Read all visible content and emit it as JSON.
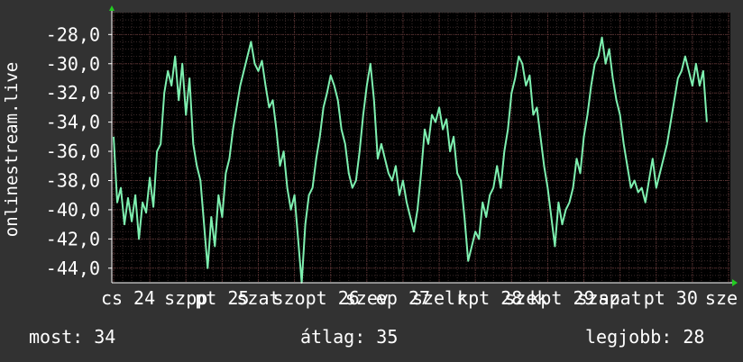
{
  "chart_data": {
    "type": "line",
    "ylabel": "onlinestream.live",
    "ylim": [
      -45,
      -26.5
    ],
    "y_ticks": [
      "-28,0",
      "-30,0",
      "-32,0",
      "-34,0",
      "-36,0",
      "-38,0",
      "-40,0",
      "-42,0",
      "-44,0"
    ],
    "y_tick_values": [
      -28,
      -30,
      -32,
      -34,
      -36,
      -38,
      -40,
      -42,
      -44
    ],
    "x_ticks": [
      {
        "label": "cs 24",
        "x": 0.2
      },
      {
        "label": "szpp",
        "x": 1.0
      },
      {
        "label": "pt 25",
        "x": 1.5
      },
      {
        "label": "szat",
        "x": 2.0
      },
      {
        "label": "szopt 26",
        "x": 2.8
      },
      {
        "label": "szev",
        "x": 3.5
      },
      {
        "label": "ep 27",
        "x": 4.0
      },
      {
        "label": "szelr",
        "x": 4.5
      },
      {
        "label": "kpt 28",
        "x": 5.2
      },
      {
        "label": "szek",
        "x": 5.7
      },
      {
        "label": "kpt 29",
        "x": 6.2
      },
      {
        "label": "szap",
        "x": 6.7
      },
      {
        "label": "szat",
        "x": 7.0
      },
      {
        "label": "pt 30",
        "x": 7.7
      },
      {
        "label": "sze",
        "x": 8.4
      }
    ],
    "xlim": [
      0,
      8.5
    ],
    "grid": true,
    "series": [
      {
        "color": "#7ef0b0",
        "points": [
          [
            0.0,
            -35.0
          ],
          [
            0.05,
            -39.5
          ],
          [
            0.1,
            -38.5
          ],
          [
            0.15,
            -41.0
          ],
          [
            0.2,
            -39.2
          ],
          [
            0.25,
            -40.8
          ],
          [
            0.3,
            -39.0
          ],
          [
            0.35,
            -42.0
          ],
          [
            0.4,
            -39.5
          ],
          [
            0.45,
            -40.2
          ],
          [
            0.5,
            -37.8
          ],
          [
            0.55,
            -39.8
          ],
          [
            0.6,
            -36.0
          ],
          [
            0.65,
            -35.5
          ],
          [
            0.7,
            -32.0
          ],
          [
            0.75,
            -30.5
          ],
          [
            0.8,
            -31.5
          ],
          [
            0.85,
            -29.5
          ],
          [
            0.9,
            -32.5
          ],
          [
            0.95,
            -30.0
          ],
          [
            1.0,
            -33.5
          ],
          [
            1.05,
            -31.0
          ],
          [
            1.1,
            -35.5
          ],
          [
            1.15,
            -37.0
          ],
          [
            1.2,
            -38.0
          ],
          [
            1.25,
            -41.0
          ],
          [
            1.3,
            -44.0
          ],
          [
            1.35,
            -40.5
          ],
          [
            1.4,
            -42.5
          ],
          [
            1.45,
            -39.0
          ],
          [
            1.5,
            -40.5
          ],
          [
            1.55,
            -37.5
          ],
          [
            1.6,
            -36.5
          ],
          [
            1.65,
            -34.5
          ],
          [
            1.7,
            -33.0
          ],
          [
            1.75,
            -31.5
          ],
          [
            1.8,
            -30.5
          ],
          [
            1.85,
            -29.5
          ],
          [
            1.9,
            -28.5
          ],
          [
            1.95,
            -30.0
          ],
          [
            2.0,
            -30.5
          ],
          [
            2.05,
            -29.8
          ],
          [
            2.1,
            -31.5
          ],
          [
            2.15,
            -33.0
          ],
          [
            2.2,
            -32.5
          ],
          [
            2.25,
            -34.5
          ],
          [
            2.3,
            -37.0
          ],
          [
            2.35,
            -36.0
          ],
          [
            2.4,
            -38.5
          ],
          [
            2.45,
            -40.0
          ],
          [
            2.5,
            -39.0
          ],
          [
            2.55,
            -42.0
          ],
          [
            2.6,
            -45.0
          ],
          [
            2.65,
            -41.0
          ],
          [
            2.7,
            -39.0
          ],
          [
            2.75,
            -38.5
          ],
          [
            2.8,
            -36.5
          ],
          [
            2.85,
            -35.0
          ],
          [
            2.9,
            -33.0
          ],
          [
            2.95,
            -32.0
          ],
          [
            3.0,
            -30.8
          ],
          [
            3.05,
            -31.5
          ],
          [
            3.1,
            -32.5
          ],
          [
            3.15,
            -34.5
          ],
          [
            3.2,
            -35.5
          ],
          [
            3.25,
            -37.5
          ],
          [
            3.3,
            -38.5
          ],
          [
            3.35,
            -38.0
          ],
          [
            3.4,
            -36.0
          ],
          [
            3.45,
            -33.5
          ],
          [
            3.5,
            -31.5
          ],
          [
            3.55,
            -30.0
          ],
          [
            3.6,
            -32.5
          ],
          [
            3.65,
            -36.5
          ],
          [
            3.7,
            -35.5
          ],
          [
            3.75,
            -36.5
          ],
          [
            3.8,
            -37.5
          ],
          [
            3.85,
            -38.0
          ],
          [
            3.9,
            -37.0
          ],
          [
            3.95,
            -39.0
          ],
          [
            4.0,
            -38.0
          ],
          [
            4.05,
            -39.5
          ],
          [
            4.1,
            -40.5
          ],
          [
            4.15,
            -41.5
          ],
          [
            4.2,
            -40.0
          ],
          [
            4.25,
            -37.5
          ],
          [
            4.3,
            -34.5
          ],
          [
            4.35,
            -35.5
          ],
          [
            4.4,
            -33.5
          ],
          [
            4.45,
            -34.0
          ],
          [
            4.5,
            -33.0
          ],
          [
            4.55,
            -34.5
          ],
          [
            4.6,
            -33.8
          ],
          [
            4.65,
            -36.0
          ],
          [
            4.7,
            -35.0
          ],
          [
            4.75,
            -37.5
          ],
          [
            4.8,
            -38.0
          ],
          [
            4.85,
            -40.5
          ],
          [
            4.9,
            -43.5
          ],
          [
            4.95,
            -42.5
          ],
          [
            5.0,
            -41.5
          ],
          [
            5.05,
            -42.0
          ],
          [
            5.1,
            -39.5
          ],
          [
            5.15,
            -40.5
          ],
          [
            5.2,
            -39.0
          ],
          [
            5.25,
            -38.5
          ],
          [
            5.3,
            -37.0
          ],
          [
            5.35,
            -38.5
          ],
          [
            5.4,
            -36.0
          ],
          [
            5.45,
            -34.5
          ],
          [
            5.5,
            -32.0
          ],
          [
            5.55,
            -31.0
          ],
          [
            5.6,
            -29.5
          ],
          [
            5.65,
            -30.0
          ],
          [
            5.7,
            -31.5
          ],
          [
            5.75,
            -30.8
          ],
          [
            5.8,
            -33.5
          ],
          [
            5.85,
            -33.0
          ],
          [
            5.9,
            -35.0
          ],
          [
            5.95,
            -37.0
          ],
          [
            6.0,
            -38.5
          ],
          [
            6.05,
            -40.5
          ],
          [
            6.1,
            -42.5
          ],
          [
            6.15,
            -39.5
          ],
          [
            6.2,
            -41.0
          ],
          [
            6.25,
            -40.0
          ],
          [
            6.3,
            -39.5
          ],
          [
            6.35,
            -38.5
          ],
          [
            6.4,
            -36.5
          ],
          [
            6.45,
            -37.5
          ],
          [
            6.5,
            -35.0
          ],
          [
            6.55,
            -33.5
          ],
          [
            6.6,
            -31.5
          ],
          [
            6.65,
            -30.0
          ],
          [
            6.7,
            -29.5
          ],
          [
            6.75,
            -28.2
          ],
          [
            6.8,
            -30.0
          ],
          [
            6.85,
            -29.0
          ],
          [
            6.9,
            -31.0
          ],
          [
            6.95,
            -32.5
          ],
          [
            7.0,
            -33.5
          ],
          [
            7.05,
            -35.5
          ],
          [
            7.1,
            -37.0
          ],
          [
            7.15,
            -38.5
          ],
          [
            7.2,
            -38.0
          ],
          [
            7.25,
            -38.8
          ],
          [
            7.3,
            -38.5
          ],
          [
            7.35,
            -39.5
          ],
          [
            7.4,
            -38.0
          ],
          [
            7.45,
            -36.5
          ],
          [
            7.5,
            -38.5
          ],
          [
            7.55,
            -37.5
          ],
          [
            7.6,
            -36.5
          ],
          [
            7.65,
            -35.5
          ],
          [
            7.7,
            -34.0
          ],
          [
            7.75,
            -32.5
          ],
          [
            7.8,
            -31.0
          ],
          [
            7.85,
            -30.5
          ],
          [
            7.9,
            -29.5
          ],
          [
            7.95,
            -30.5
          ],
          [
            8.0,
            -31.5
          ],
          [
            8.05,
            -30.0
          ],
          [
            8.1,
            -31.5
          ],
          [
            8.15,
            -30.5
          ],
          [
            8.2,
            -34.0
          ]
        ]
      }
    ]
  },
  "stats": {
    "current": "most: 34",
    "average": "átlag: 35",
    "best": "legjobb: 28"
  }
}
